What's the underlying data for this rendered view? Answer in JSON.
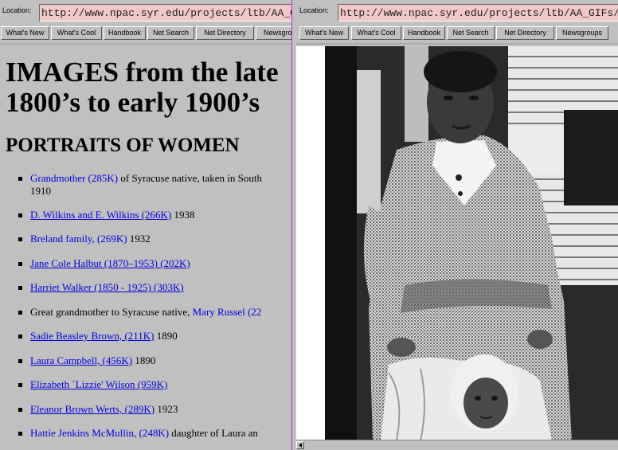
{
  "left_window": {
    "location_label": "Location:",
    "url": "http://www.npac.syr.edu/projects/ltb/AA_GIFs",
    "buttons": [
      "What's New",
      "What's Cool",
      "Handbook",
      "Net Search",
      "Net Directory",
      "Newsgroups"
    ]
  },
  "right_window": {
    "location_label": "Location:",
    "url": "http://www.npac.syr.edu/projects/ltb/AA_GIFs/",
    "buttons": [
      "What's New",
      "What's Cool",
      "Handbook",
      "Net Search",
      "Net Directory",
      "Newsgroups"
    ],
    "photo_description_icon": "portrait-photo"
  },
  "page": {
    "heading_line1": "IMAGES from the late",
    "heading_line2": "1800’s to early 1900’s",
    "subheading": "PORTRAITS OF WOMEN",
    "items": [
      {
        "link": "Grandmother (285K)",
        "after": " of Syracuse native, taken in South",
        "cont": "1910"
      },
      {
        "link": "D. Wilkins and E. Wilkins (266K)",
        "after": " 1938"
      },
      {
        "link": "Breland family, (269K)",
        "after": " 1932"
      },
      {
        "link": "Jane Cole Halbut (1870–1953) (202K)",
        "after": ""
      },
      {
        "link": "Harriet Walker (1850 - 1925) (303K)",
        "after": ""
      },
      {
        "before": "Great grandmother to Syracuse native, ",
        "link": "Mary Russel (22",
        "after": ""
      },
      {
        "link": "Sadie Beasley Brown, (211K)",
        "after": " 1890"
      },
      {
        "link": "Laura Campbell, (456K)",
        "after": " 1890"
      },
      {
        "link": "Elizabeth `Lizzie' Wilson (959K)",
        "after": ""
      },
      {
        "link": "Eleanor Brown Werts, (289K)",
        "after": " 1923"
      },
      {
        "link": "Hattie Jenkins McMullin, (248K)",
        "after": " daughter of Laura an"
      }
    ]
  },
  "colors": {
    "chrome": "#c0c0c0",
    "link": "#0000e0",
    "location_field": "#f0c8c8",
    "divider": "#d020d0"
  }
}
